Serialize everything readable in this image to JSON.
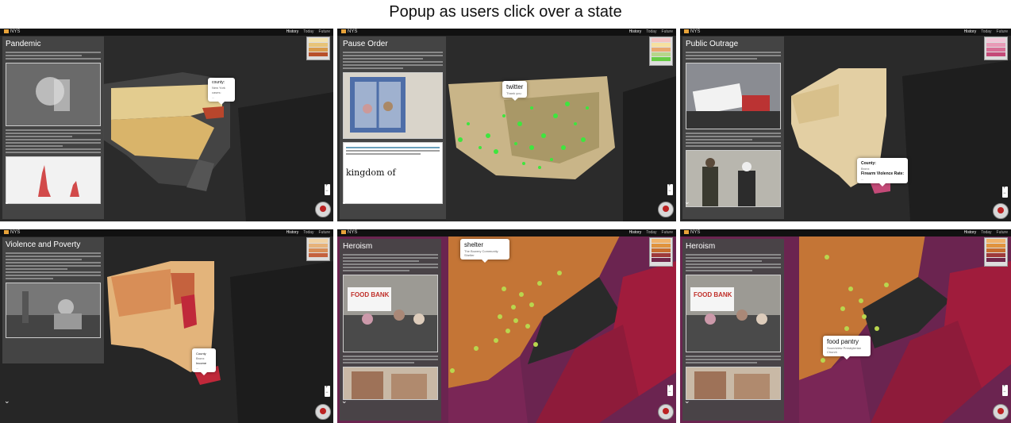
{
  "page_title": "Popup as users click over a state",
  "app": {
    "brand": "NYS",
    "tabs": [
      "History",
      "Today",
      "Future"
    ]
  },
  "panels": [
    {
      "id": "pandemic",
      "story_title": "Pandemic",
      "popup": {
        "title": "county:",
        "lines": [
          "New York",
          "cases:",
          "..."
        ]
      },
      "legend_colors": [
        "#f3e3b0",
        "#e7c478",
        "#d99c4c",
        "#b8502a",
        "#7e2318"
      ]
    },
    {
      "id": "pause-order",
      "story_title": "Pause Order",
      "popup": {
        "title": "twitter",
        "lines": [
          "Thank you"
        ]
      },
      "tweet_text": "kingdom of",
      "legend_colors": [
        "#f4c3c3",
        "#f6e0a0",
        "#e9a86f",
        "#b7d58b",
        "#66cc44"
      ]
    },
    {
      "id": "public-outrage",
      "story_title": "Public Outrage",
      "popup": {
        "title": "County:",
        "lines": [
          "Bronx",
          "Firearm Violence Rate:",
          "..."
        ]
      },
      "legend_colors": [
        "#f2c6d7",
        "#e89ab6",
        "#d86e95",
        "#c44a78",
        "#a52e5e"
      ]
    },
    {
      "id": "violence-poverty",
      "story_title": "Violence and Poverty",
      "popup": {
        "title": "County",
        "lines": [
          "Bronx",
          "Income",
          "..."
        ]
      },
      "legend_colors": [
        "#f1d3a4",
        "#e6b27a",
        "#d88e57",
        "#c5623e",
        "#a3332a"
      ]
    },
    {
      "id": "heroism-shelter",
      "story_title": "Heroism",
      "popup": {
        "title": "shelter",
        "lines": [
          "The Bowery Community Shelter"
        ]
      },
      "photo_banner": "FOOD BANK",
      "legend_colors": [
        "#f1b36a",
        "#e0933e",
        "#c76d2e",
        "#9e3a3a",
        "#70274a"
      ]
    },
    {
      "id": "heroism-pantry",
      "story_title": "Heroism",
      "popup": {
        "title": "food pantry",
        "lines": [
          "Soundview Presbyterian Church"
        ]
      },
      "photo_banner": "FOOD BANK",
      "legend_colors": [
        "#f1b36a",
        "#e0933e",
        "#c76d2e",
        "#9e3a3a",
        "#70274a"
      ]
    }
  ]
}
